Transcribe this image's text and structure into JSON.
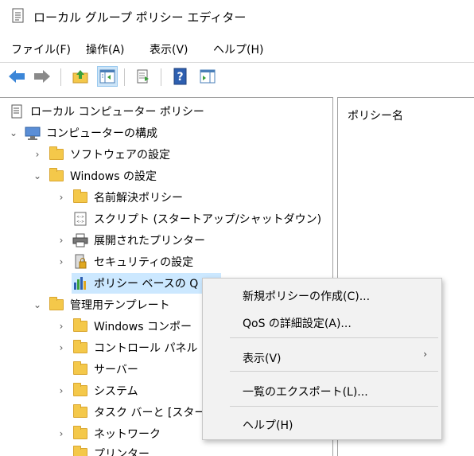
{
  "window": {
    "title": "ローカル グループ ポリシー エディター",
    "app_icon": "notepad-policy-icon"
  },
  "menu": {
    "file": "ファイル(F)",
    "action": "操作(A)",
    "view": "表示(V)",
    "help": "ヘルプ(H)"
  },
  "toolbar": {
    "icons": [
      "back-arrow-icon",
      "forward-arrow-icon",
      "up-folder-icon",
      "show-hide-tree-icon",
      "export-list-icon",
      "help-icon",
      "show-action-pane-icon"
    ]
  },
  "tree": {
    "root": "ローカル コンピューター ポリシー",
    "computer_config": "コンピューターの構成",
    "software_settings": "ソフトウェアの設定",
    "windows_settings": "Windows の設定",
    "name_resolution": "名前解決ポリシー",
    "scripts": "スクリプト (スタートアップ/シャットダウン)",
    "deployed_printers": "展開されたプリンター",
    "security_settings": "セキュリティの設定",
    "qos_policy": "ポリシー ベースの Q",
    "admin_templates": "管理用テンプレート",
    "windows_components": "Windows コンポー",
    "control_panel": "コントロール パネル",
    "server": "サーバー",
    "system": "システム",
    "taskbar": "タスク バーと [スター",
    "network": "ネットワーク",
    "printers": "プリンター"
  },
  "right_pane": {
    "column_header": "ポリシー名"
  },
  "context_menu": {
    "new_policy": "新規ポリシーの作成(C)...",
    "advanced_qos": "QoS の詳細設定(A)...",
    "view": "表示(V)",
    "export_list": "一覧のエクスポート(L)...",
    "help": "ヘルプ(H)"
  },
  "colors": {
    "selection": "#cce8ff",
    "folder": "#f4c84a",
    "menu_bg": "#f2f2f2"
  }
}
